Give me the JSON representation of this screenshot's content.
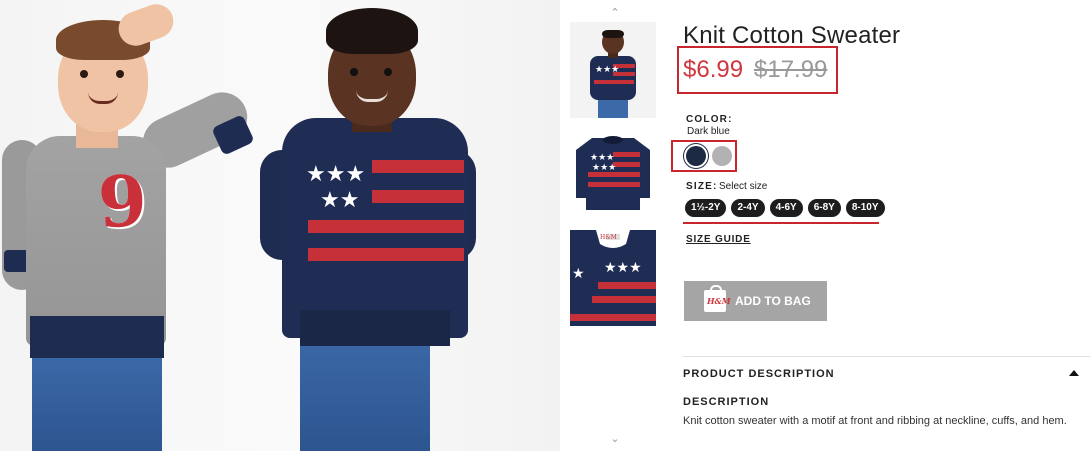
{
  "product": {
    "title": "Knit Cotton Sweater",
    "sale_price": "$6.99",
    "original_price": "$17.99"
  },
  "color": {
    "label": "COLOR:",
    "selected": "Dark blue",
    "swatches": [
      {
        "name": "Dark blue",
        "hex": "#1c2a44"
      },
      {
        "name": "Grey",
        "hex": "#b2b2b2"
      }
    ]
  },
  "size": {
    "label": "SIZE:",
    "hint": "Select size",
    "options": [
      "1½-2Y",
      "2-4Y",
      "4-6Y",
      "6-8Y",
      "8-10Y"
    ],
    "guide_link": "SIZE GUIDE"
  },
  "cart": {
    "button_label": "ADD TO BAG",
    "icon": "shopping-bag-icon",
    "icon_brand_text": "H&M"
  },
  "description": {
    "section_title": "PRODUCT DESCRIPTION",
    "subheading": "DESCRIPTION",
    "text": "Knit cotton sweater with a motif at front and ribbing at neckline, cuffs, and hem."
  },
  "gallery": {
    "main_image": "two-boys-wearing-sweaters-photo",
    "thumbnails": [
      "boy-flag-sweater-thumb",
      "flag-sweater-flat-thumb",
      "sweater-detail-thumb"
    ],
    "scroll_up_icon": "chevron-up-icon",
    "scroll_down_icon": "chevron-down-icon"
  },
  "colors": {
    "highlight": "#c8262e",
    "sale": "#d0363e",
    "button_bg": "#a5a5a5",
    "pill_bg": "#1d1d1d"
  }
}
